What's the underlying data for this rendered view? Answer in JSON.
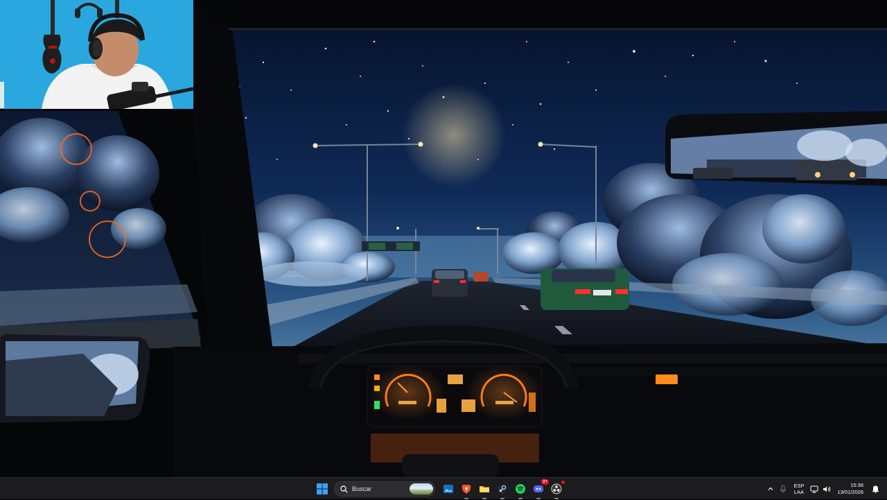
{
  "desktop": {
    "wallpaper": "night-drive-dashboard-wallpaper",
    "webcam_overlay": "streamer-webcam"
  },
  "taskbar": {
    "search": {
      "placeholder": "Buscar"
    },
    "apps": [
      {
        "name": "start-button",
        "icon": "windows-logo"
      },
      {
        "name": "file-explorer",
        "icon": "folder-icon"
      },
      {
        "name": "brave-browser",
        "icon": "brave-lion-icon"
      },
      {
        "name": "steam",
        "icon": "steam-icon"
      },
      {
        "name": "spotify",
        "icon": "spotify-icon"
      },
      {
        "name": "discord",
        "icon": "discord-icon",
        "badge": "9+"
      },
      {
        "name": "obs-studio",
        "icon": "obs-icon"
      }
    ],
    "tray": {
      "language_top": "ESP",
      "language_bottom": "LAA",
      "time": "15:36",
      "date": "13/01/2026"
    }
  },
  "colors": {
    "taskbar_bg": "#1c1c1f",
    "accent": "#0078d4",
    "sky": "#0b1a3a",
    "gauge_orange": "#ff7a1a"
  }
}
